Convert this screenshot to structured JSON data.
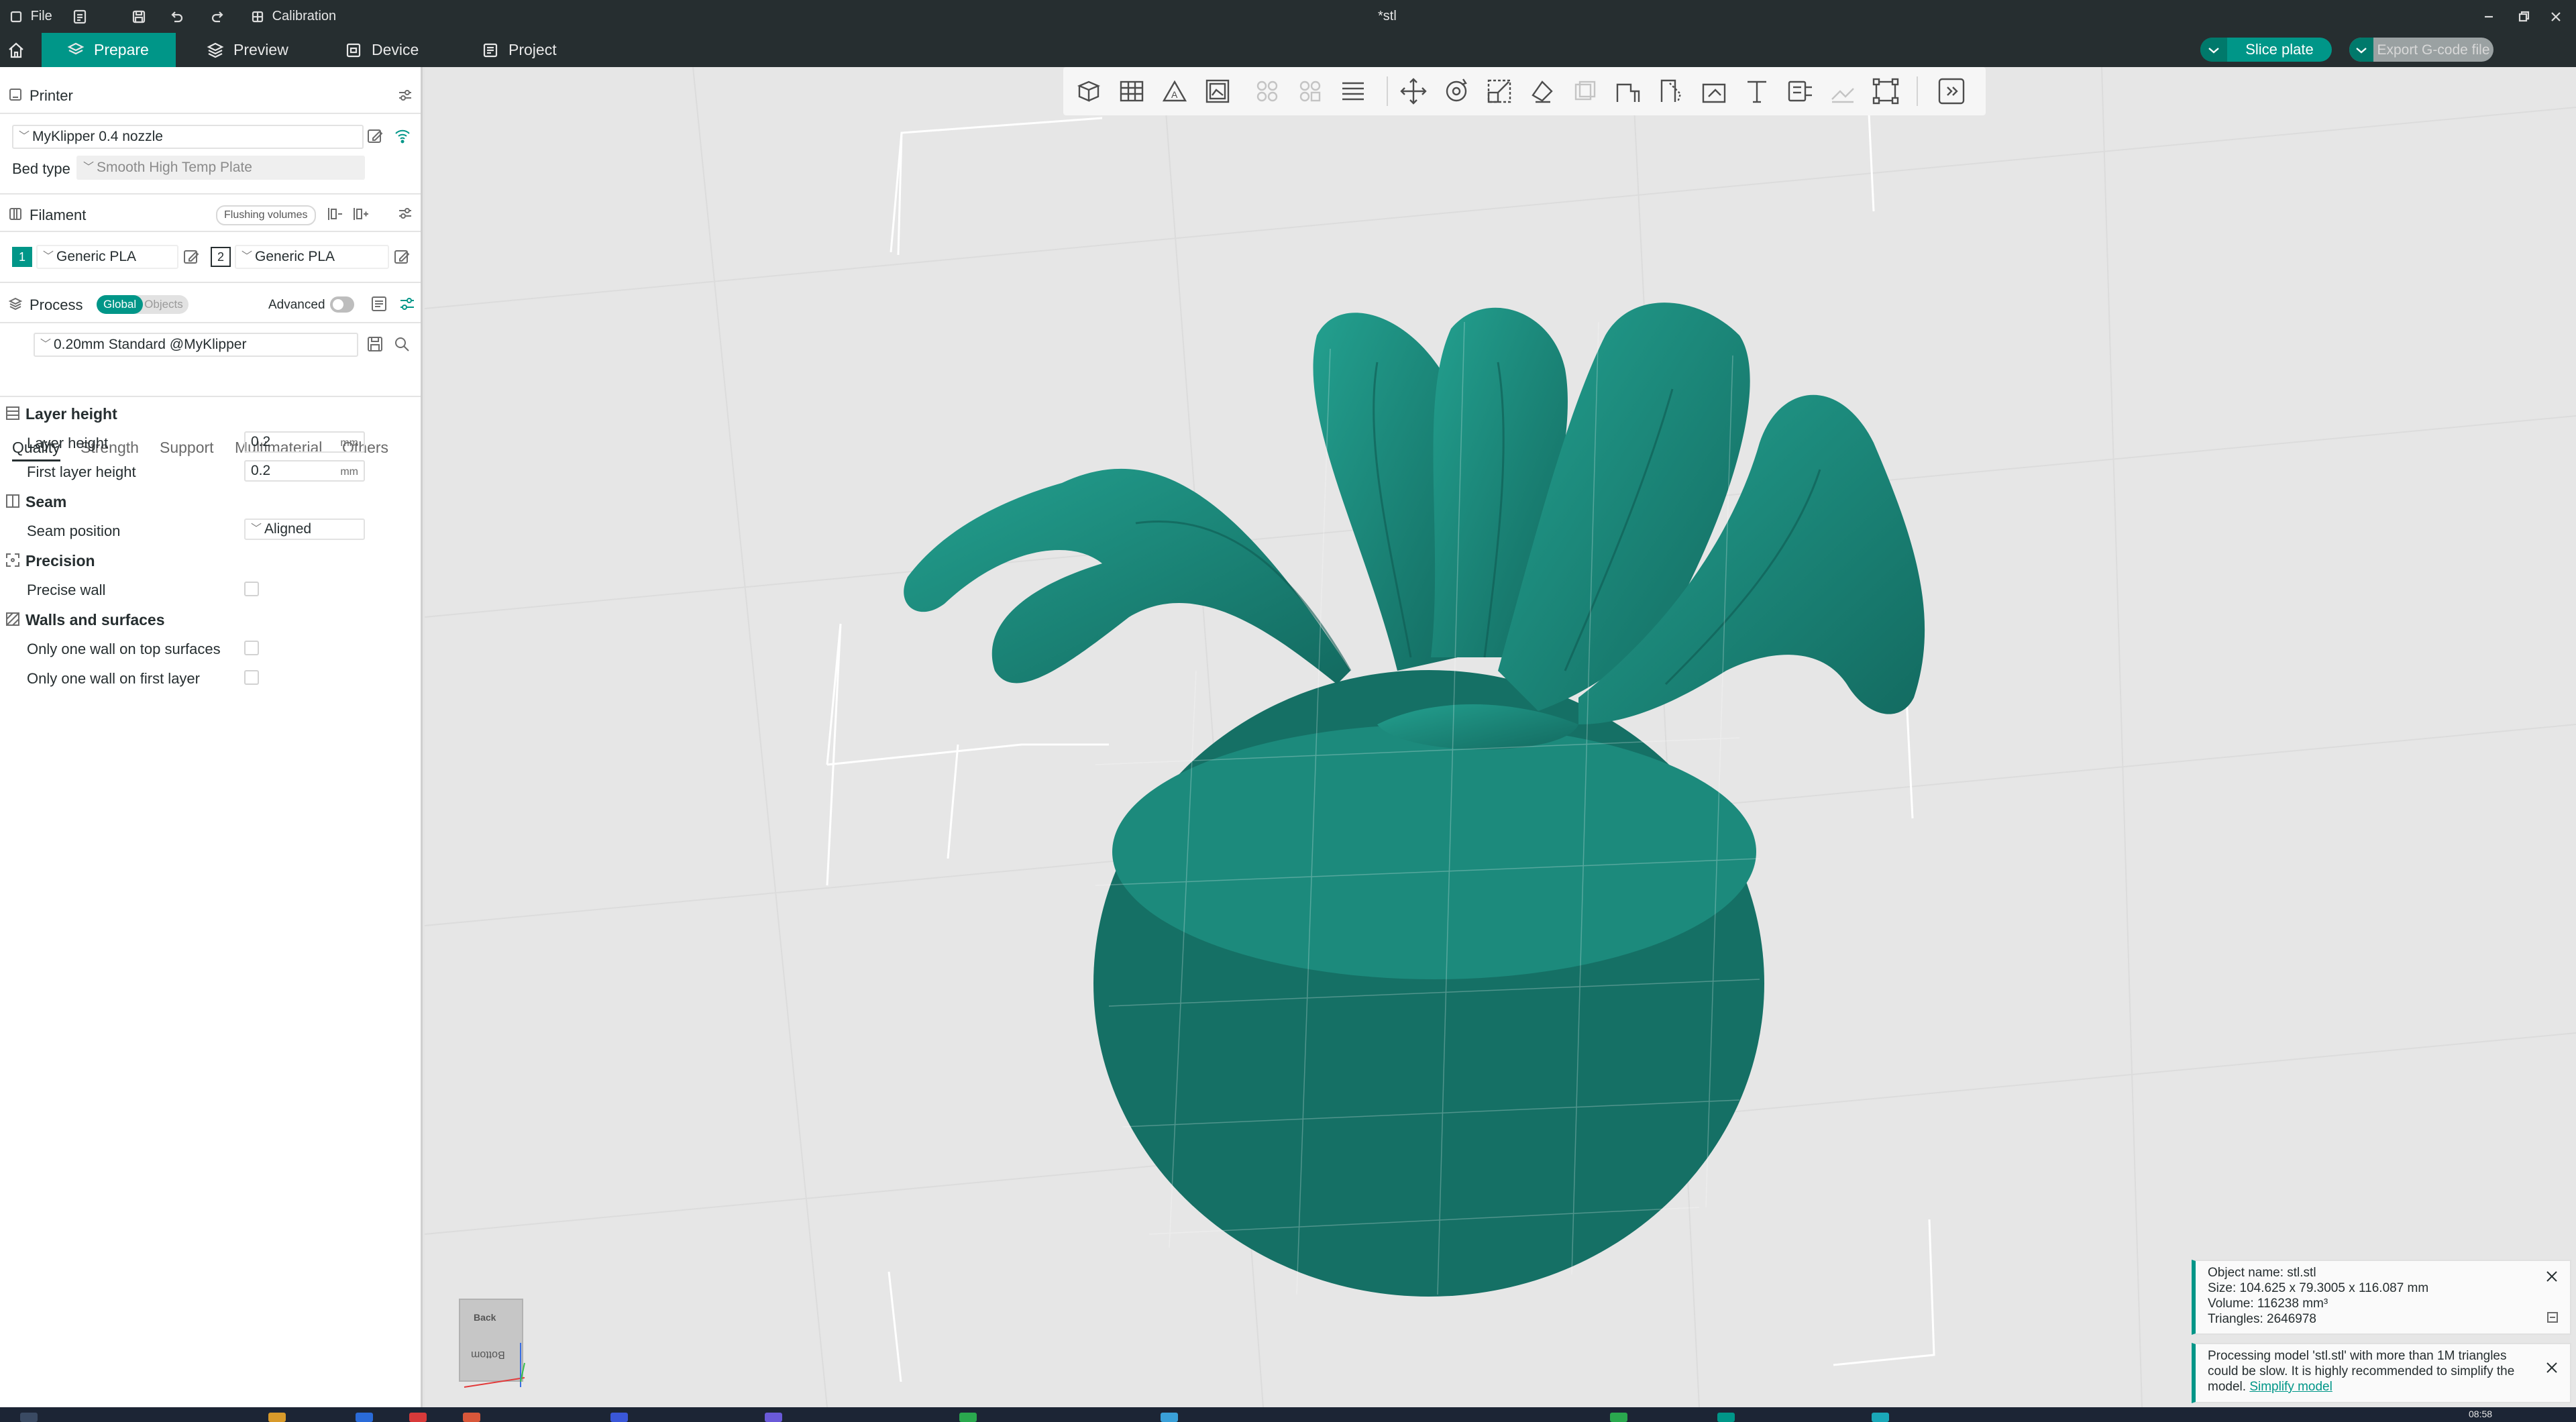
{
  "titlebar": {
    "file_label": "File",
    "calibration_label": "Calibration",
    "document_title": "*stl"
  },
  "tabs": [
    {
      "label": "Prepare",
      "active": true
    },
    {
      "label": "Preview",
      "active": false
    },
    {
      "label": "Device",
      "active": false
    },
    {
      "label": "Project",
      "active": false
    }
  ],
  "actions": {
    "slice_label": "Slice plate",
    "export_label": "Export G-code file"
  },
  "printer": {
    "section_title": "Printer",
    "name": "MyKlipper 0.4 nozzle",
    "bed_type_label": "Bed type",
    "bed_type_value": "Smooth High Temp Plate"
  },
  "filament": {
    "section_title": "Filament",
    "flushing_label": "Flushing volumes",
    "slots": [
      {
        "index": "1",
        "name": "Generic PLA"
      },
      {
        "index": "2",
        "name": "Generic PLA"
      }
    ]
  },
  "process": {
    "section_title": "Process",
    "global_label": "Global",
    "objects_label": "Objects",
    "advanced_label": "Advanced",
    "profile": "0.20mm Standard @MyKlipper",
    "tabs": [
      "Quality",
      "Strength",
      "Support",
      "Multimaterial",
      "Others"
    ],
    "groups": {
      "layer_height": {
        "title": "Layer height",
        "layer_height_label": "Layer height",
        "layer_height_value": "0.2",
        "first_layer_label": "First layer height",
        "first_layer_value": "0.2",
        "unit": "mm"
      },
      "seam": {
        "title": "Seam",
        "position_label": "Seam position",
        "position_value": "Aligned"
      },
      "precision": {
        "title": "Precision",
        "precise_wall_label": "Precise wall"
      },
      "walls": {
        "title": "Walls and surfaces",
        "top_label": "Only one wall on top surfaces",
        "first_layer_label": "Only one wall on first layer"
      }
    }
  },
  "view_cube": {
    "top_face": "Back",
    "front_face": "Bottom"
  },
  "notifications": {
    "object": {
      "name": "Object name: stl.stl",
      "size": "Size: 104.625 x 79.3005 x 116.087 mm",
      "volume": "Volume: 116238 mm³",
      "triangles": "Triangles: 2646978"
    },
    "warning": {
      "text": "Processing model 'stl.stl' with more than 1M triangles could be slow. It is highly recommended to simplify the model.",
      "link": "Simplify model"
    }
  },
  "taskbar": {
    "clock": "08:58"
  },
  "colors": {
    "accent": "#009688",
    "header_bg": "#262e30",
    "model": "#1a8276",
    "viewport_bg": "#e6e6e6"
  }
}
